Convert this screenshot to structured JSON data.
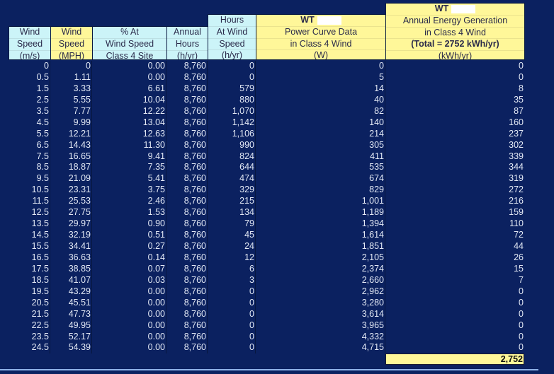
{
  "headers": {
    "wind_ms": [
      "Wind",
      "Speed",
      "(m/s)"
    ],
    "wind_mph": [
      "Wind",
      "Speed",
      "(MPH)"
    ],
    "pct": [
      "% At",
      "Wind Speed",
      "Class 4 Site"
    ],
    "annual_hours": [
      "Annual",
      "Hours",
      "(h/yr)"
    ],
    "hours_at_wind": [
      "Hours",
      "At Wind",
      "Speed",
      "(h/yr)"
    ],
    "power_curve": [
      "WT",
      "Power Curve Data",
      "in Class 4 Wind",
      "(W)"
    ],
    "energy": [
      "WT",
      "Annual Energy Generation",
      "in Class 4 Wind",
      "(Total = 2752 kWh/yr)",
      "(kWh/yr)"
    ]
  },
  "rows": [
    [
      "0",
      "0",
      "0.00",
      "8,760",
      "0",
      "0",
      "0"
    ],
    [
      "0.5",
      "1.11",
      "0.00",
      "8,760",
      "0",
      "5",
      "0"
    ],
    [
      "1.5",
      "3.33",
      "6.61",
      "8,760",
      "579",
      "14",
      "8"
    ],
    [
      "2.5",
      "5.55",
      "10.04",
      "8,760",
      "880",
      "40",
      "35"
    ],
    [
      "3.5",
      "7.77",
      "12.22",
      "8,760",
      "1,070",
      "82",
      "87"
    ],
    [
      "4.5",
      "9.99",
      "13.04",
      "8,760",
      "1,142",
      "140",
      "160"
    ],
    [
      "5.5",
      "12.21",
      "12.63",
      "8,760",
      "1,106",
      "214",
      "237"
    ],
    [
      "6.5",
      "14.43",
      "11.30",
      "8,760",
      "990",
      "305",
      "302"
    ],
    [
      "7.5",
      "16.65",
      "9.41",
      "8,760",
      "824",
      "411",
      "339"
    ],
    [
      "8.5",
      "18.87",
      "7.35",
      "8,760",
      "644",
      "535",
      "344"
    ],
    [
      "9.5",
      "21.09",
      "5.41",
      "8,760",
      "474",
      "674",
      "319"
    ],
    [
      "10.5",
      "23.31",
      "3.75",
      "8,760",
      "329",
      "829",
      "272"
    ],
    [
      "11.5",
      "25.53",
      "2.46",
      "8,760",
      "215",
      "1,001",
      "216"
    ],
    [
      "12.5",
      "27.75",
      "1.53",
      "8,760",
      "134",
      "1,189",
      "159"
    ],
    [
      "13.5",
      "29.97",
      "0.90",
      "8,760",
      "79",
      "1,394",
      "110"
    ],
    [
      "14.5",
      "32.19",
      "0.51",
      "8,760",
      "45",
      "1,614",
      "72"
    ],
    [
      "15.5",
      "34.41",
      "0.27",
      "8,760",
      "24",
      "1,851",
      "44"
    ],
    [
      "16.5",
      "36.63",
      "0.14",
      "8,760",
      "12",
      "2,105",
      "26"
    ],
    [
      "17.5",
      "38.85",
      "0.07",
      "8,760",
      "6",
      "2,374",
      "15"
    ],
    [
      "18.5",
      "41.07",
      "0.03",
      "8,760",
      "3",
      "2,660",
      "7"
    ],
    [
      "19.5",
      "43.29",
      "0.00",
      "8,760",
      "0",
      "2,962",
      "0"
    ],
    [
      "20.5",
      "45.51",
      "0.00",
      "8,760",
      "0",
      "3,280",
      "0"
    ],
    [
      "21.5",
      "47.73",
      "0.00",
      "8,760",
      "0",
      "3,614",
      "0"
    ],
    [
      "22.5",
      "49.95",
      "0.00",
      "8,760",
      "0",
      "3,965",
      "0"
    ],
    [
      "23.5",
      "52.17",
      "0.00",
      "8,760",
      "0",
      "4,332",
      "0"
    ],
    [
      "24.5",
      "54.39",
      "0.00",
      "8,760",
      "0",
      "4,715",
      "0"
    ]
  ],
  "total": "2,752",
  "colors": {
    "background": "#0b2160",
    "header_blue": "#ccf4f8",
    "header_yellow": "#fff799",
    "text": "#e2e8f4"
  }
}
